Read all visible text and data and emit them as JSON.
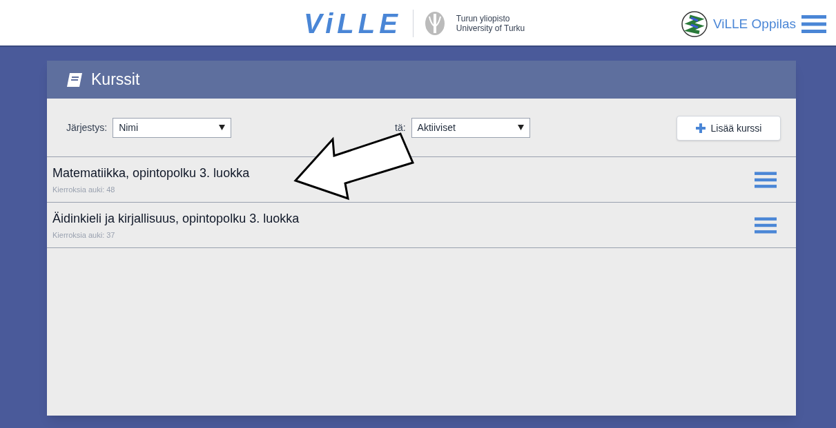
{
  "header": {
    "logo": "ViLLE",
    "university": [
      "Turun yliopisto",
      "University of Turku"
    ],
    "user": "ViLLE Oppilas"
  },
  "card": {
    "title": "Kurssit"
  },
  "filters": [
    {
      "label": "Järjestys:",
      "value": "Nimi"
    },
    {
      "label": "tä:",
      "value": "Aktiiviset"
    }
  ],
  "add_button": {
    "label": "Lisää kurssi"
  },
  "courses": [
    {
      "name": "Matematiikka, opintopolku 3. luokka",
      "info": "Kierroksia auki: 48"
    },
    {
      "name": "Äidinkieli ja kirjallisuus, opintopolku 3. luokka",
      "info": "Kierroksia auki: 37"
    }
  ]
}
